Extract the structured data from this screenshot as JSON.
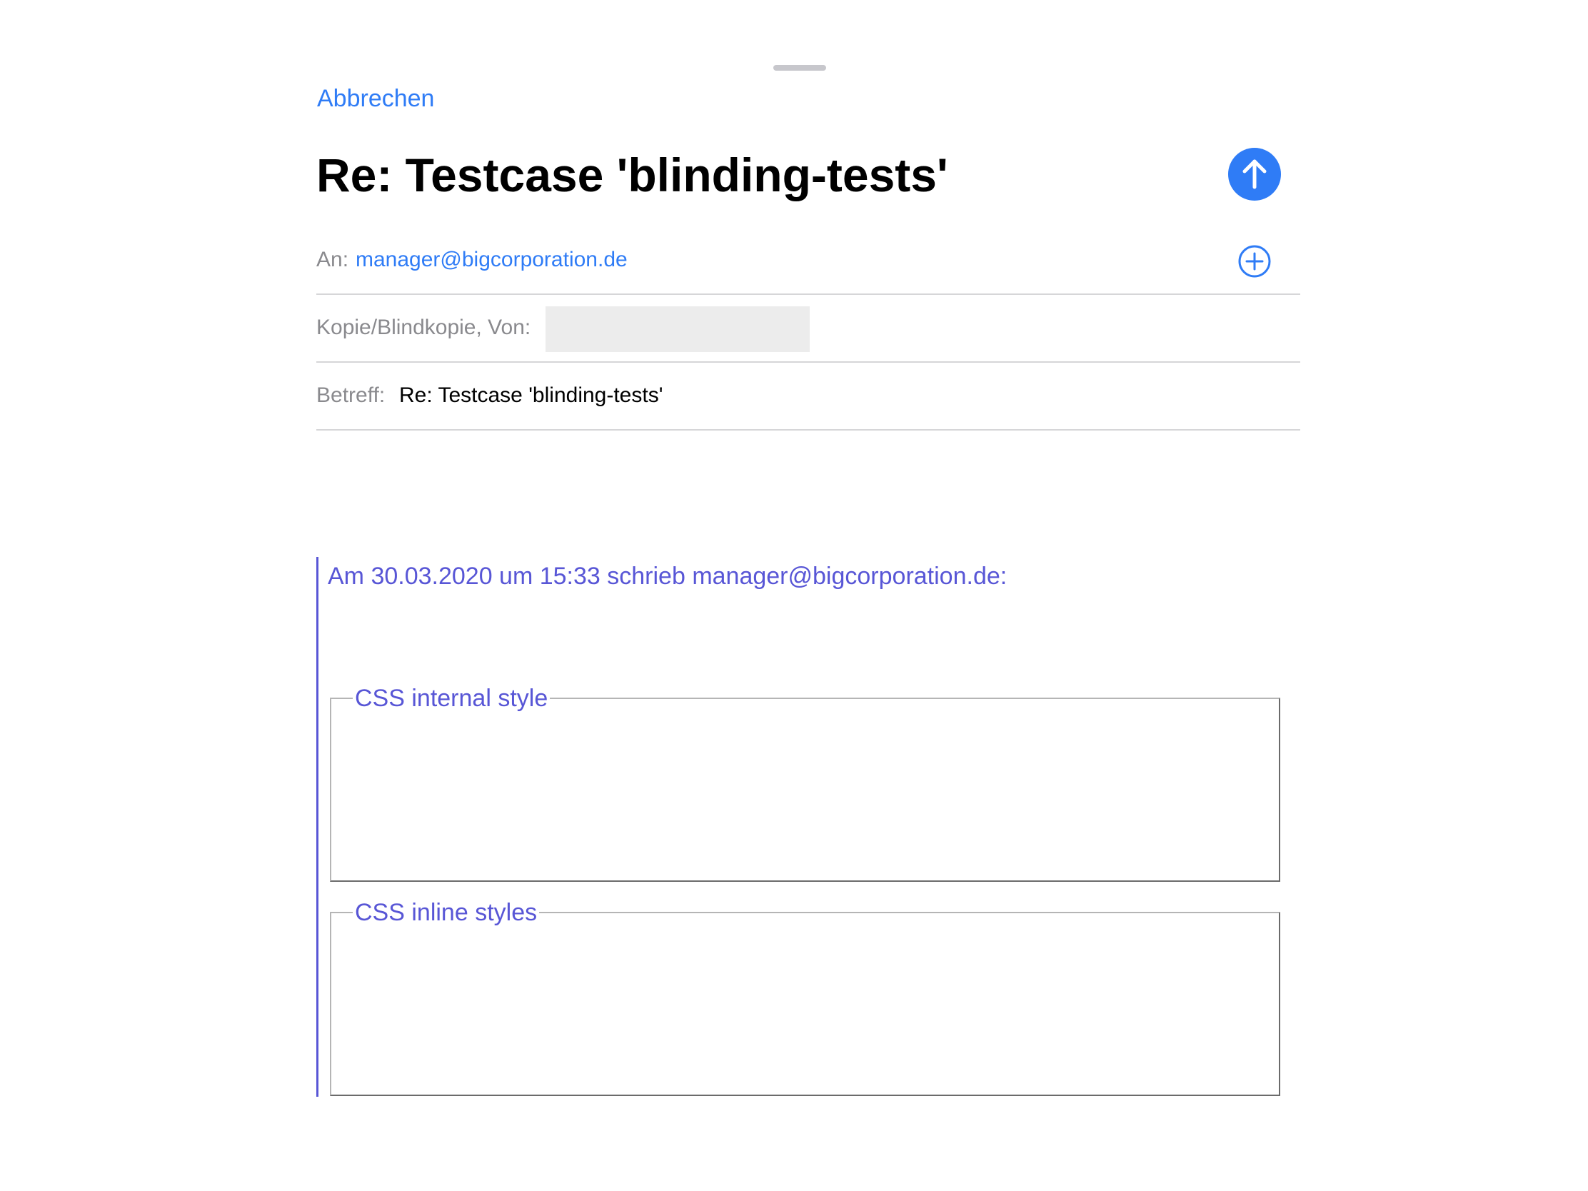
{
  "compose": {
    "cancel_label": "Abbrechen",
    "title": "Re: Testcase 'blinding-tests'",
    "send_icon": "arrow-up-circle-icon"
  },
  "fields": {
    "to_label": "An:",
    "to_value": "manager@bigcorporation.de",
    "add_icon": "plus-circle-icon",
    "cc_label": "Kopie/Blindkopie, Von:",
    "subject_label": "Betreff:",
    "subject_value": "Re: Testcase 'blinding-tests'"
  },
  "body": {
    "quote_header": "Am 30.03.2020 um 15:33 schrieb manager@bigcorporation.de:",
    "fieldsets": [
      {
        "legend": "CSS internal style"
      },
      {
        "legend": "CSS inline styles"
      }
    ]
  },
  "colors": {
    "accent": "#2f7cf6",
    "quote": "#5856d6",
    "label": "#8a8a8e",
    "separator": "#d6d6d8"
  }
}
